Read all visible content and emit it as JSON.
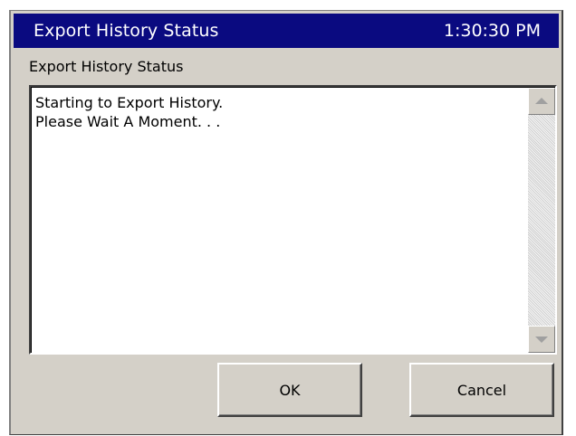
{
  "window": {
    "title": "Export History Status",
    "time": "1:30:30 PM"
  },
  "status_group": {
    "label": "Export History Status",
    "lines": [
      "Starting to Export History.",
      "Please Wait A Moment. . ."
    ]
  },
  "buttons": {
    "ok_label": "OK",
    "cancel_label": "Cancel"
  },
  "icons": {
    "scroll_up": "scroll-up-arrow-icon",
    "scroll_down": "scroll-down-arrow-icon"
  },
  "colors": {
    "titlebar": "#0a0a80",
    "dialog_background": "#d4d0c8"
  }
}
